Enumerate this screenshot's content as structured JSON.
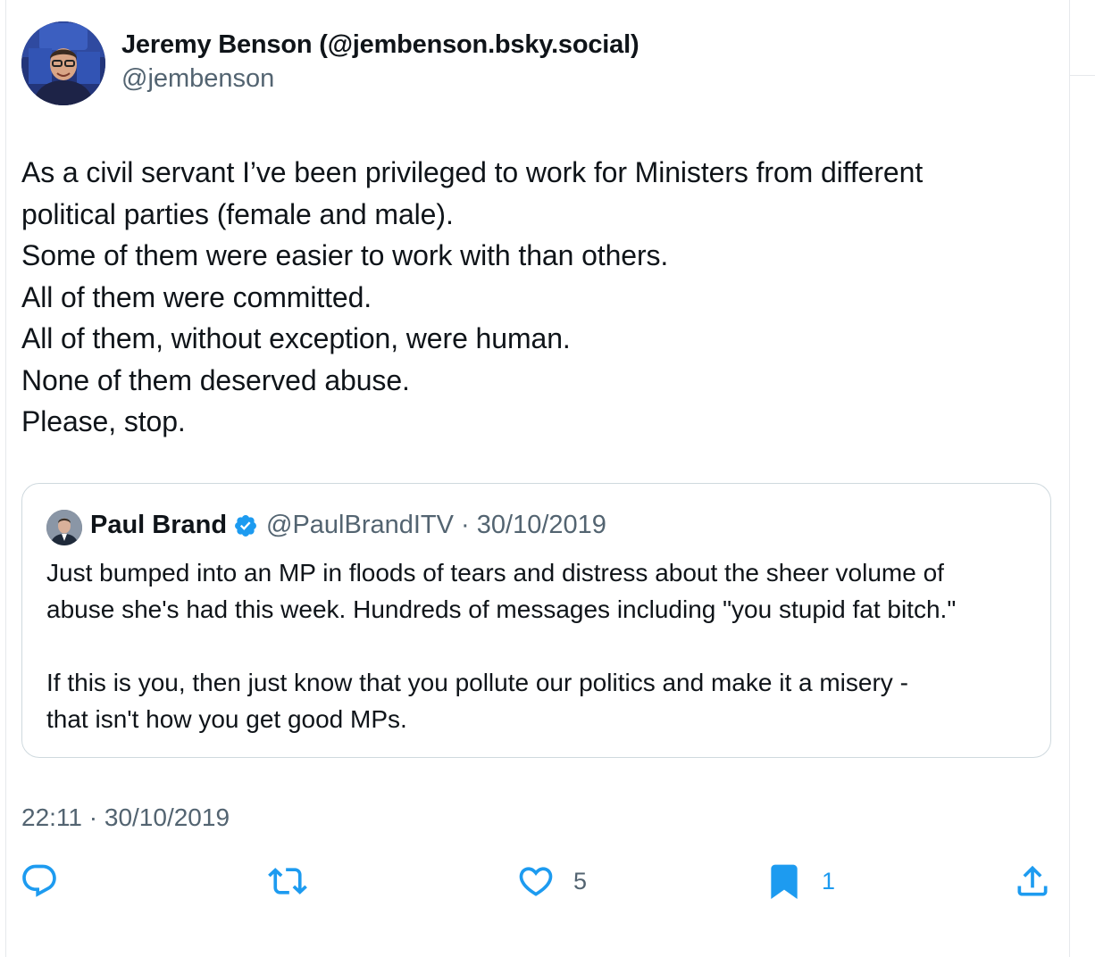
{
  "author": {
    "name": "Jeremy Benson (@jembenson.bsky.social)",
    "handle": "@jembenson",
    "avatar_icon": "profile-photo"
  },
  "tweet": {
    "lines": [
      "As a civil servant I’ve been privileged to work for Ministers from different",
      "political parties (female and male).",
      "Some of them were easier to work with than others.",
      "All of them were committed.",
      "All of them, without exception, were human.",
      "None of them deserved abuse.",
      "Please, stop."
    ],
    "timestamp": "22:11 · 30/10/2019"
  },
  "quoted": {
    "name": "Paul Brand",
    "verified_icon": "verified-badge-icon",
    "meta": "@PaulBrandITV · 30/10/2019",
    "paragraph1": [
      "Just bumped into an MP in floods of tears and distress about the sheer volume of",
      "abuse she's had this week. Hundreds of messages including \"you stupid fat bitch.\""
    ],
    "paragraph2": [
      "If this is you, then just know that you pollute our politics and make it a misery -",
      "that isn't how you get good MPs."
    ]
  },
  "actions": {
    "reply_count": "",
    "retweet_count": "",
    "like_count": "5",
    "bookmark_count": "1"
  },
  "colors": {
    "accent": "#1d9bf0",
    "text": "#0f1419",
    "muted": "#536471",
    "border": "#cfd9de"
  }
}
